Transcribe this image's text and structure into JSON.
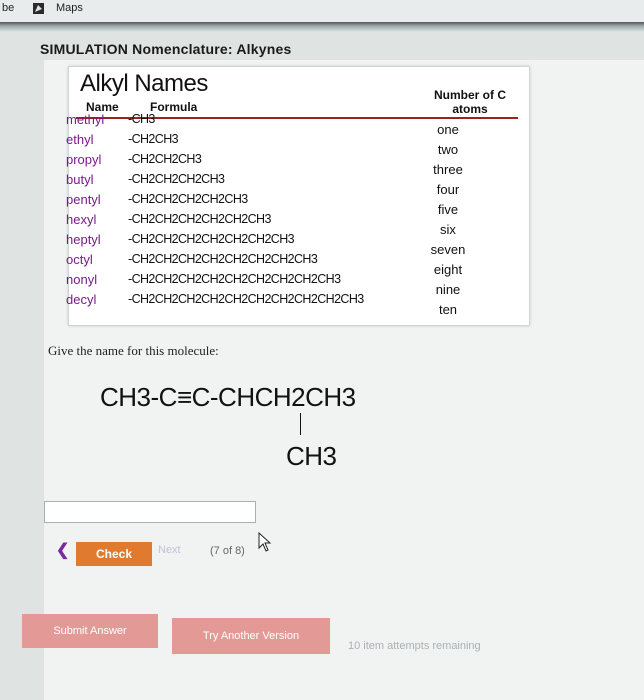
{
  "browser": {
    "partial_tab": "be",
    "maps_icon": "maps-icon",
    "maps_label": "Maps"
  },
  "simulation": {
    "title": "SIMULATION Nomenclature: Alkynes"
  },
  "alkyl_table": {
    "heading": "Alkyl Names",
    "col_name": "Name",
    "col_formula": "Formula",
    "col_number": "Number of C atoms",
    "rows": [
      {
        "name": "methyl",
        "formula": "-CH3",
        "count": "one"
      },
      {
        "name": "ethyl",
        "formula": "-CH2CH3",
        "count": "two"
      },
      {
        "name": "propyl",
        "formula": "-CH2CH2CH3",
        "count": "three"
      },
      {
        "name": "butyl",
        "formula": "-CH2CH2CH2CH3",
        "count": "four"
      },
      {
        "name": "pentyl",
        "formula": "-CH2CH2CH2CH2CH3",
        "count": "five"
      },
      {
        "name": "hexyl",
        "formula": "-CH2CH2CH2CH2CH2CH3",
        "count": "six"
      },
      {
        "name": "heptyl",
        "formula": "-CH2CH2CH2CH2CH2CH2CH3",
        "count": "seven"
      },
      {
        "name": "octyl",
        "formula": "-CH2CH2CH2CH2CH2CH2CH2CH3",
        "count": "eight"
      },
      {
        "name": "nonyl",
        "formula": "-CH2CH2CH2CH2CH2CH2CH2CH2CH3",
        "count": "nine"
      },
      {
        "name": "decyl",
        "formula": "-CH2CH2CH2CH2CH2CH2CH2CH2CH2CH3",
        "count": "ten"
      }
    ]
  },
  "question": {
    "prompt": "Give the name for this molecule:",
    "molecule_main": "CH3-C≡C-CHCH2CH3",
    "molecule_branch": "CH3",
    "answer_value": ""
  },
  "navigation": {
    "prev_symbol": "❮",
    "check_label": "Check",
    "next_label": "Next",
    "progress": "(7 of 8)"
  },
  "footer": {
    "submit_label": "Submit Answer",
    "try_label": "Try Another Version",
    "attempts": "10 item attempts remaining"
  }
}
